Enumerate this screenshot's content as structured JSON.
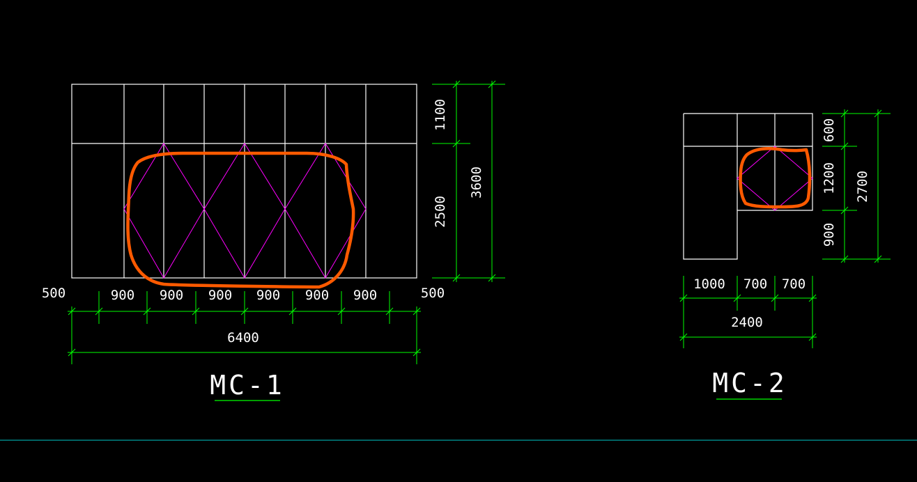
{
  "colors": {
    "background": "#000000",
    "outline": "#ffffff",
    "dimension": "#00ff00",
    "opening_pattern": "#ff00ff",
    "markup": "#ff5a00",
    "ground_line": "#00c8c8"
  },
  "mc1": {
    "title": "MC-1",
    "dims": {
      "left_edge": "500",
      "segments": [
        "900",
        "900",
        "900",
        "900",
        "900",
        "900"
      ],
      "right_edge": "500",
      "total_width": "6400",
      "top_height": "1100",
      "bottom_height": "2500",
      "total_height": "3600"
    }
  },
  "mc2": {
    "title": "MC-2",
    "dims": {
      "segments": [
        "1000",
        "700",
        "700"
      ],
      "total_width": "2400",
      "top_height": "600",
      "mid_height": "1200",
      "bottom_height": "900",
      "total_height": "2700"
    }
  }
}
